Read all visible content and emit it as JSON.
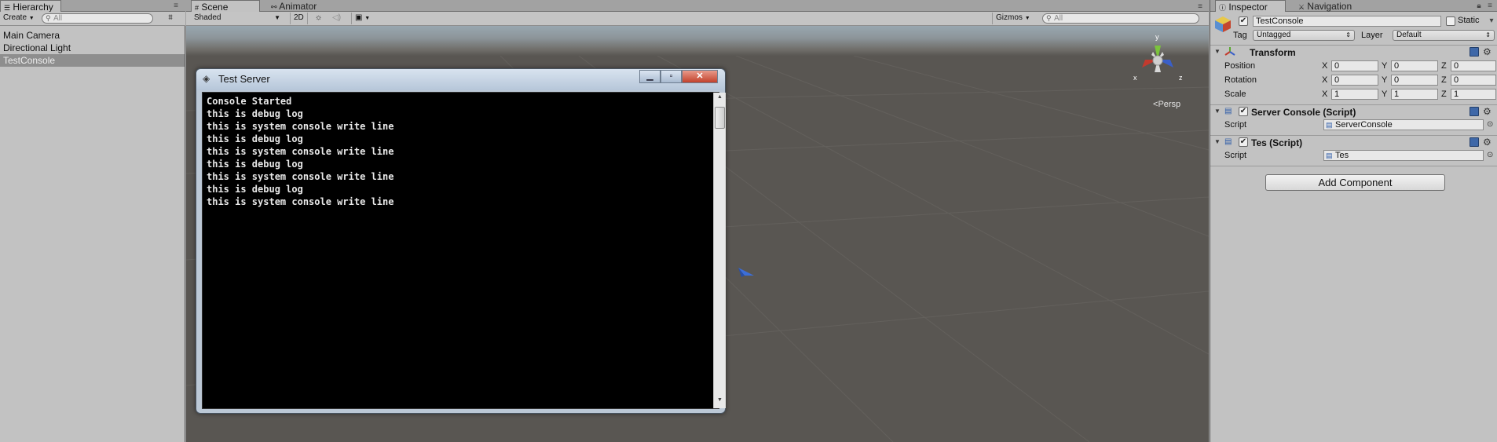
{
  "hierarchy": {
    "tab_label": "Hierarchy",
    "create_label": "Create",
    "search_placeholder": "All",
    "items": [
      {
        "label": "Main Camera"
      },
      {
        "label": "Directional Light"
      },
      {
        "label": "TestConsole"
      }
    ]
  },
  "scene": {
    "tabs": [
      {
        "label": "Scene"
      },
      {
        "label": "Animator"
      }
    ],
    "shading_mode": "Shaded",
    "mode_2d_label": "2D",
    "gizmos_label": "Gizmos",
    "search_placeholder": "All",
    "persp_label": "Persp",
    "gizmo_axes": {
      "y": "y",
      "x": "x",
      "z": "z"
    }
  },
  "console_window": {
    "title": "Test Server",
    "lines": [
      "Console Started",
      "this is debug log",
      "this is system console write line",
      "this is debug log",
      "this is system console write line",
      "this is debug log",
      "this is system console write line",
      "this is debug log",
      "this is system console write line"
    ]
  },
  "inspector": {
    "tabs": [
      {
        "label": "Inspector"
      },
      {
        "label": "Navigation"
      }
    ],
    "object_name": "TestConsole",
    "static_label": "Static",
    "tag_label": "Tag",
    "tag_value": "Untagged",
    "layer_label": "Layer",
    "layer_value": "Default",
    "transform": {
      "title": "Transform",
      "rows": [
        {
          "label": "Position",
          "x": "0",
          "y": "0",
          "z": "0"
        },
        {
          "label": "Rotation",
          "x": "0",
          "y": "0",
          "z": "0"
        },
        {
          "label": "Scale",
          "x": "1",
          "y": "1",
          "z": "1"
        }
      ],
      "axis_x": "X",
      "axis_y": "Y",
      "axis_z": "Z"
    },
    "components": [
      {
        "title": "Server Console (Script)",
        "script_label": "Script",
        "script_value": "ServerConsole"
      },
      {
        "title": "Tes (Script)",
        "script_label": "Script",
        "script_value": "Tes"
      }
    ],
    "add_component_label": "Add Component"
  }
}
